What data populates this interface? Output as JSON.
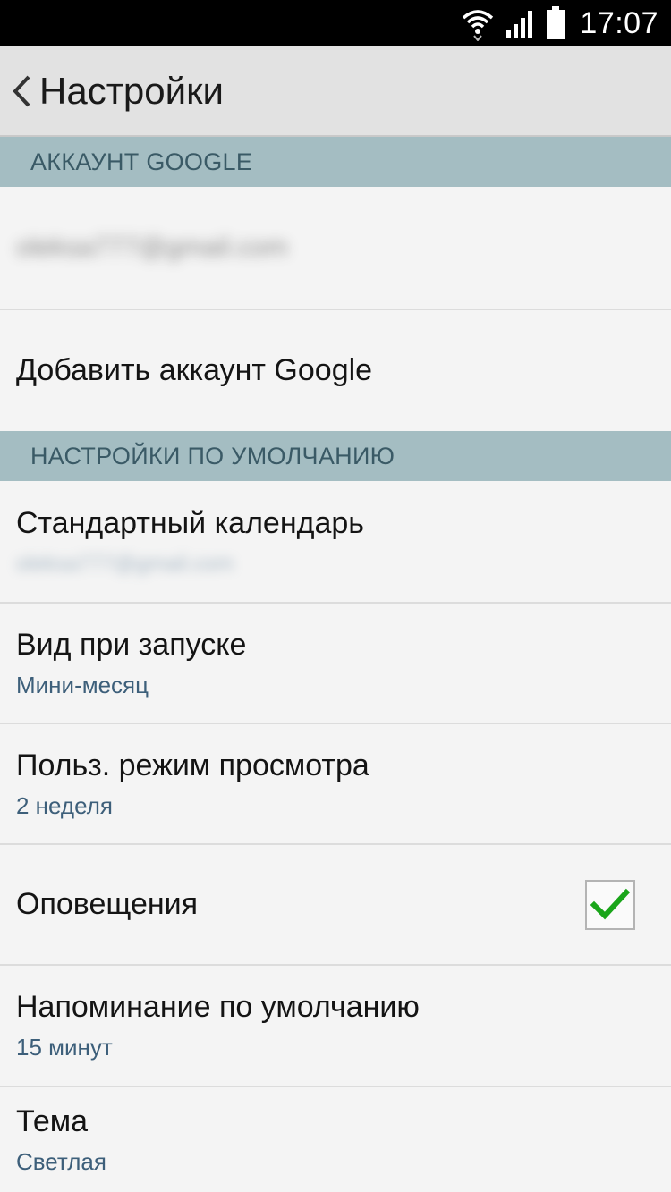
{
  "status_bar": {
    "time": "17:07",
    "icons": [
      "wifi-icon",
      "signal-icon",
      "battery-icon"
    ]
  },
  "action_bar": {
    "title": "Настройки",
    "back_icon": "chevron-left-icon"
  },
  "sections": {
    "google_account": {
      "header": "АККАУНТ GOOGLE",
      "account_email": "oleksa777@gmail.com",
      "add_account_label": "Добавить аккаунт Google"
    },
    "defaults": {
      "header": "НАСТРОЙКИ ПО УМОЛЧАНИЮ",
      "items": [
        {
          "title": "Стандартный календарь",
          "value": "oleksa777@gmail.com"
        },
        {
          "title": "Вид при запуске",
          "value": "Мини-месяц"
        },
        {
          "title": "Польз. режим просмотра",
          "value": "2 неделя"
        },
        {
          "title": "Оповещения",
          "checked": true
        },
        {
          "title": "Напоминание по умолчанию",
          "value": "15 минут"
        },
        {
          "title": "Тема",
          "value": "Светлая"
        }
      ]
    }
  },
  "colors": {
    "section_header_bg": "#a4bdc2",
    "section_header_text": "#3a5a66",
    "subtitle_text": "#3d5f7a",
    "check_mark": "#1aa51a"
  }
}
